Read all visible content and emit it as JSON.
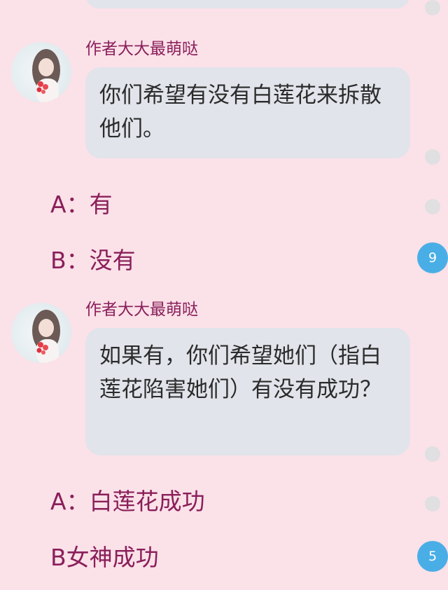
{
  "messages": [
    {
      "author": "作者大大最萌哒",
      "text": "你们希望有没有白莲花来拆散他们。",
      "options": [
        "A：有",
        "B：没有"
      ],
      "count": "9"
    },
    {
      "author": "作者大大最萌哒",
      "text": "如果有，你们希望她们（指白莲花陷害她们）有没有成功？",
      "options": [
        "A：白莲花成功",
        "B女神成功"
      ],
      "count": "5"
    }
  ],
  "colors": {
    "background": "#fbe1e8",
    "bubble": "#e1e4ea",
    "author_text": "#8a1f5a",
    "option_text": "#8a1f5a",
    "badge": "#4aaee6",
    "dot": "#e0dfe1"
  },
  "icons": {
    "avatar": "user-avatar-photo",
    "badge": "count-badge",
    "dot": "scroll-indicator-dot"
  }
}
